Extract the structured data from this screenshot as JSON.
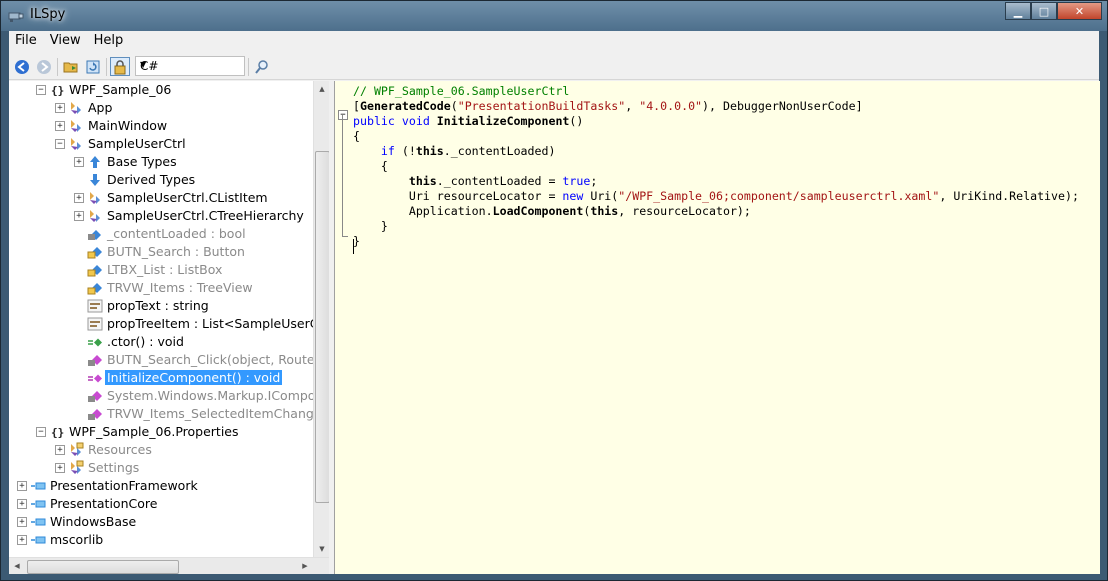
{
  "window": {
    "title": "ILSpy"
  },
  "menu": {
    "items": [
      "File",
      "View",
      "Help"
    ]
  },
  "toolbar": {
    "language": "C#"
  },
  "tree": {
    "rows": [
      {
        "label": "WPF_Sample_06",
        "indent": 1,
        "expander": "−",
        "icon": "namespace-icon",
        "style": "normal"
      },
      {
        "label": "App",
        "indent": 2,
        "expander": "+",
        "icon": "class-icon",
        "style": "normal"
      },
      {
        "label": "MainWindow",
        "indent": 2,
        "expander": "+",
        "icon": "class-icon",
        "style": "normal"
      },
      {
        "label": "SampleUserCtrl",
        "indent": 2,
        "expander": "−",
        "icon": "class-icon",
        "style": "normal"
      },
      {
        "label": "Base Types",
        "indent": 3,
        "expander": "+",
        "icon": "base-types-icon",
        "style": "normal"
      },
      {
        "label": "Derived Types",
        "indent": 3,
        "expander": "",
        "icon": "derived-types-icon",
        "style": "normal"
      },
      {
        "label": "SampleUserCtrl.CListItem",
        "indent": 3,
        "expander": "+",
        "icon": "class-icon",
        "style": "normal"
      },
      {
        "label": "SampleUserCtrl.CTreeHierarchy",
        "indent": 3,
        "expander": "+",
        "icon": "class-icon",
        "style": "normal"
      },
      {
        "label": "_contentLoaded : bool",
        "indent": 3,
        "expander": "",
        "icon": "private-field-icon",
        "style": "dim"
      },
      {
        "label": "BUTN_Search : Button",
        "indent": 3,
        "expander": "",
        "icon": "internal-field-icon",
        "style": "dim"
      },
      {
        "label": "LTBX_List : ListBox",
        "indent": 3,
        "expander": "",
        "icon": "internal-field-icon",
        "style": "dim"
      },
      {
        "label": "TRVW_Items : TreeView",
        "indent": 3,
        "expander": "",
        "icon": "internal-field-icon",
        "style": "dim"
      },
      {
        "label": "propText : string",
        "indent": 3,
        "expander": "",
        "icon": "property-icon",
        "style": "normal"
      },
      {
        "label": "propTreeItem : List<SampleUserCt",
        "indent": 3,
        "expander": "",
        "icon": "property-icon",
        "style": "normal"
      },
      {
        "label": ".ctor() : void",
        "indent": 3,
        "expander": "",
        "icon": "constructor-icon",
        "style": "normal"
      },
      {
        "label": "BUTN_Search_Click(object, Routed",
        "indent": 3,
        "expander": "",
        "icon": "private-method-icon",
        "style": "dim"
      },
      {
        "label": "InitializeComponent() : void",
        "indent": 3,
        "expander": "",
        "icon": "method-icon",
        "style": "selected"
      },
      {
        "label": "System.Windows.Markup.IComponen",
        "indent": 3,
        "expander": "",
        "icon": "private-method-icon",
        "style": "dim"
      },
      {
        "label": "TRVW_Items_SelectedItemChange",
        "indent": 3,
        "expander": "",
        "icon": "private-method-icon",
        "style": "dim"
      },
      {
        "label": "WPF_Sample_06.Properties",
        "indent": 1,
        "expander": "−",
        "icon": "namespace-icon",
        "style": "normal"
      },
      {
        "label": "Resources",
        "indent": 2,
        "expander": "+",
        "icon": "internal-class-icon",
        "style": "dim"
      },
      {
        "label": "Settings",
        "indent": 2,
        "expander": "+",
        "icon": "internal-class-icon",
        "style": "dim"
      },
      {
        "label": "PresentationFramework",
        "indent": 0,
        "expander": "+",
        "icon": "assembly-icon",
        "style": "normal"
      },
      {
        "label": "PresentationCore",
        "indent": 0,
        "expander": "+",
        "icon": "assembly-icon",
        "style": "normal"
      },
      {
        "label": "WindowsBase",
        "indent": 0,
        "expander": "+",
        "icon": "assembly-icon",
        "style": "normal"
      },
      {
        "label": "mscorlib",
        "indent": 0,
        "expander": "+",
        "icon": "assembly-icon",
        "style": "normal"
      }
    ]
  },
  "code": {
    "lines": [
      [
        {
          "t": "// WPF_Sample_06.SampleUserCtrl",
          "c": "comment"
        }
      ],
      [
        {
          "t": "[",
          "c": ""
        },
        {
          "t": "GeneratedCode",
          "c": "bold"
        },
        {
          "t": "(",
          "c": ""
        },
        {
          "t": "\"PresentationBuildTasks\"",
          "c": "str"
        },
        {
          "t": ", ",
          "c": ""
        },
        {
          "t": "\"4.0.0.0\"",
          "c": "str"
        },
        {
          "t": "), DebuggerNonUserCode]",
          "c": ""
        }
      ],
      [
        {
          "t": "public",
          "c": "kw"
        },
        {
          "t": " ",
          "c": ""
        },
        {
          "t": "void",
          "c": "kw"
        },
        {
          "t": " ",
          "c": ""
        },
        {
          "t": "InitializeComponent",
          "c": "bold"
        },
        {
          "t": "()",
          "c": ""
        }
      ],
      [
        {
          "t": "{",
          "c": ""
        }
      ],
      [
        {
          "t": "    ",
          "c": ""
        },
        {
          "t": "if",
          "c": "kw"
        },
        {
          "t": " (!",
          "c": ""
        },
        {
          "t": "this",
          "c": "bold"
        },
        {
          "t": "._contentLoaded)",
          "c": ""
        }
      ],
      [
        {
          "t": "    {",
          "c": ""
        }
      ],
      [
        {
          "t": "        ",
          "c": ""
        },
        {
          "t": "this",
          "c": "bold"
        },
        {
          "t": "._contentLoaded = ",
          "c": ""
        },
        {
          "t": "true",
          "c": "kw"
        },
        {
          "t": ";",
          "c": ""
        }
      ],
      [
        {
          "t": "        Uri resourceLocator = ",
          "c": ""
        },
        {
          "t": "new",
          "c": "kw"
        },
        {
          "t": " Uri(",
          "c": ""
        },
        {
          "t": "\"/WPF_Sample_06;component/sampleuserctrl.xaml\"",
          "c": "str"
        },
        {
          "t": ", UriKind.Relative);",
          "c": ""
        }
      ],
      [
        {
          "t": "        Application.",
          "c": ""
        },
        {
          "t": "LoadComponent",
          "c": "bold"
        },
        {
          "t": "(",
          "c": ""
        },
        {
          "t": "this",
          "c": "bold"
        },
        {
          "t": ", resourceLocator);",
          "c": ""
        }
      ],
      [
        {
          "t": "    }",
          "c": ""
        }
      ],
      [
        {
          "t": "}",
          "c": ""
        }
      ]
    ]
  }
}
